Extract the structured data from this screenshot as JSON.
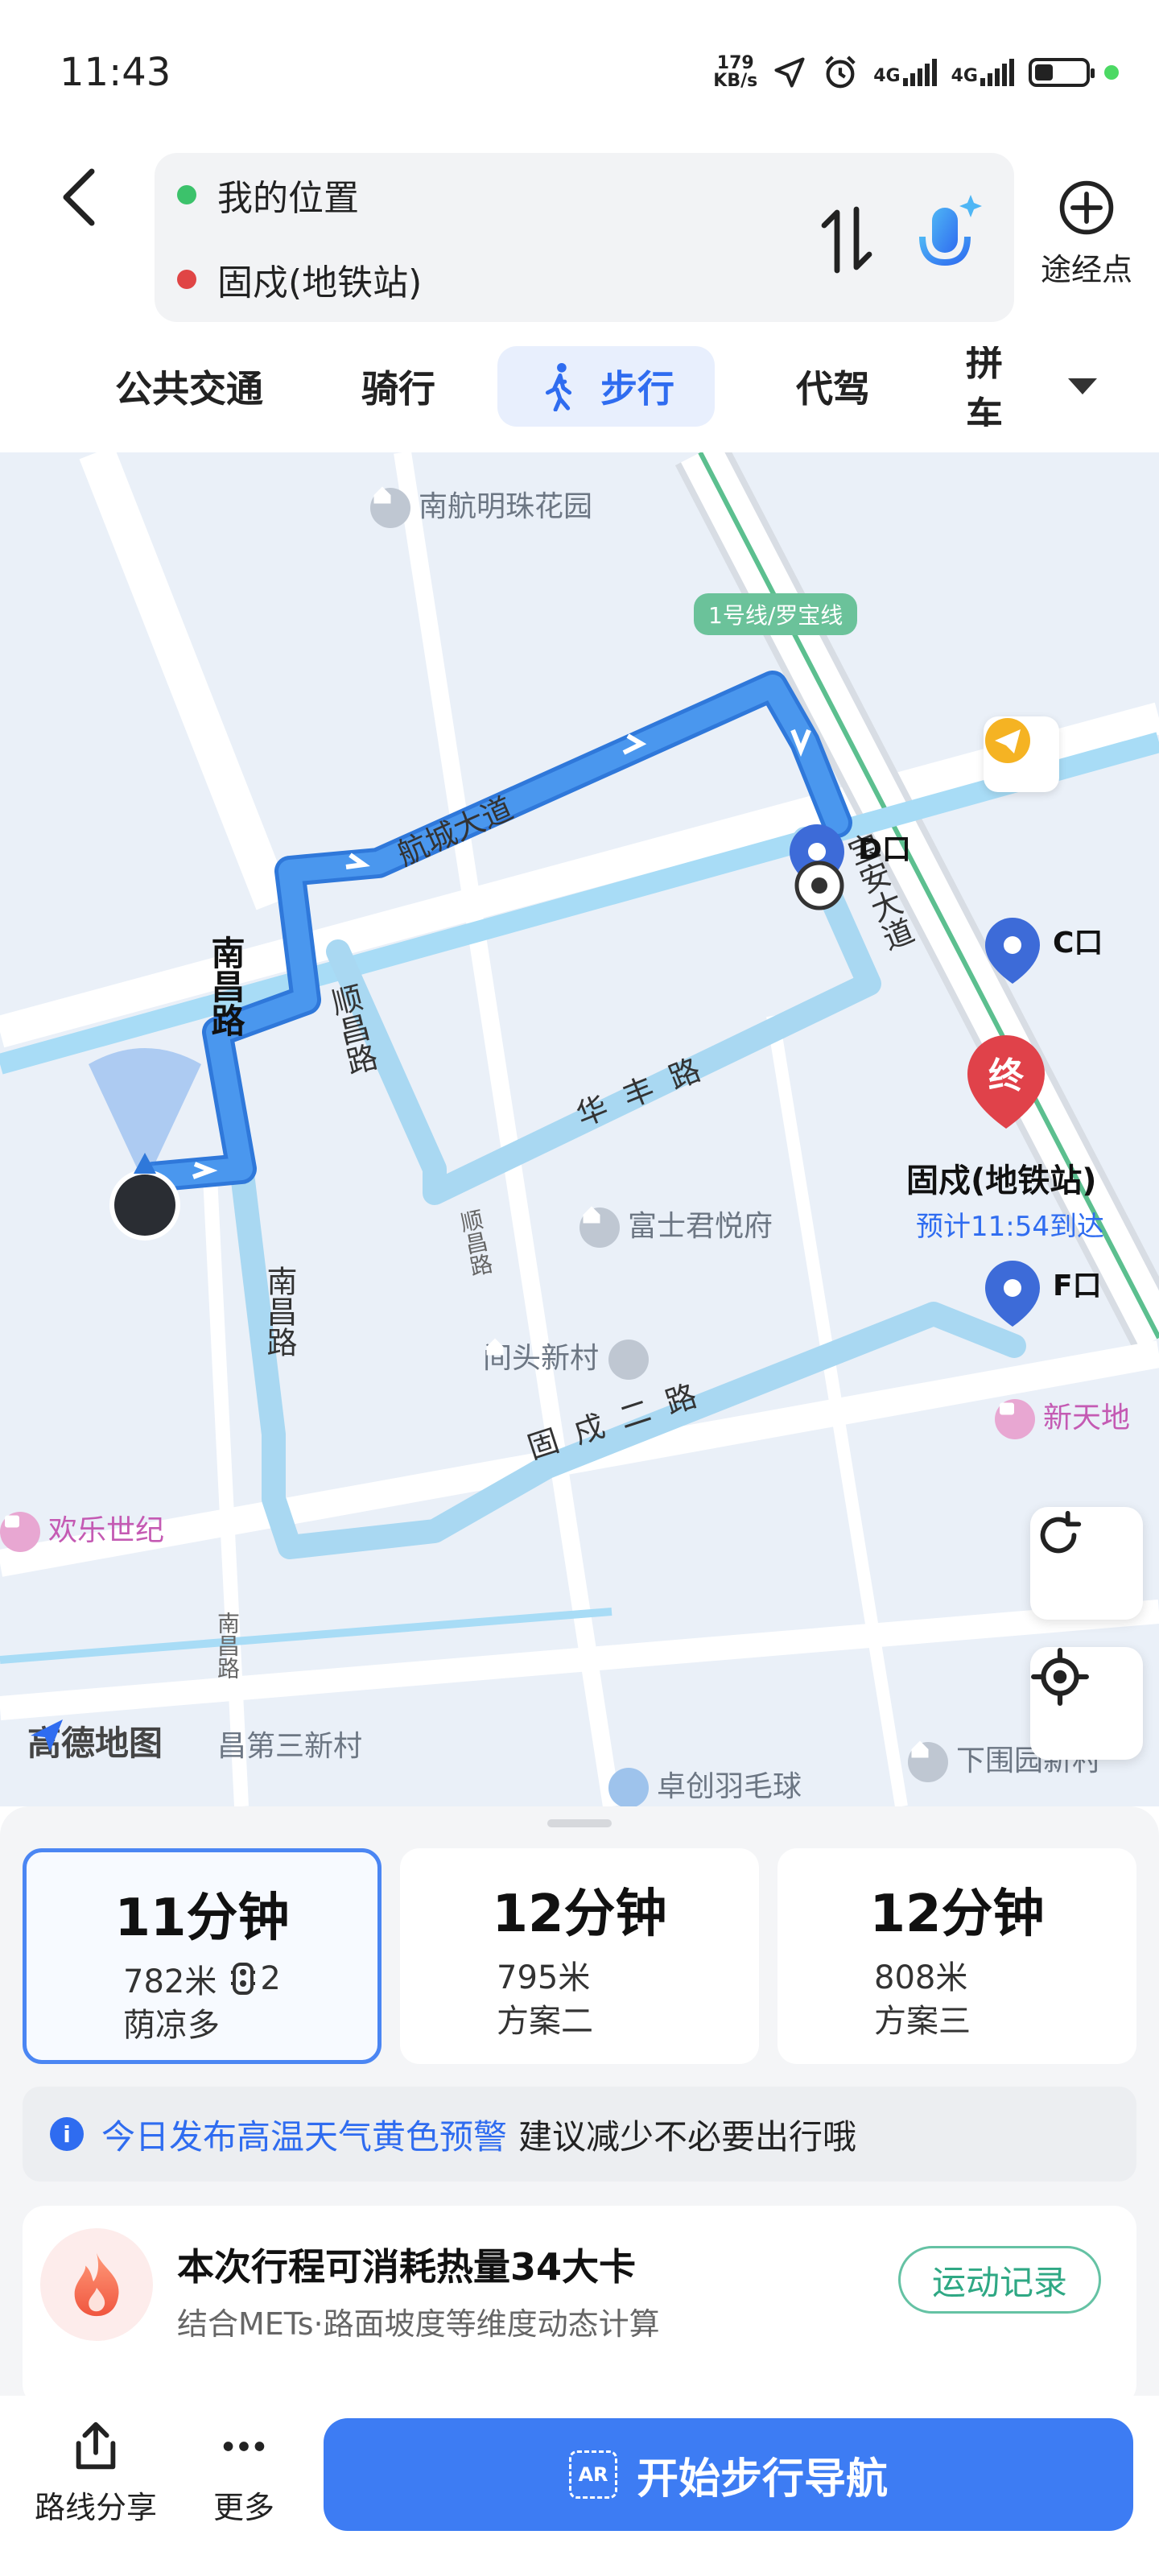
{
  "status_bar": {
    "time": "11:43",
    "net_speed_value": "179",
    "net_speed_unit": "KB/s",
    "signal1_label": "4G",
    "signal2_label": "4G",
    "icons": [
      "location-arrow-icon",
      "alarm-icon",
      "signal-icon",
      "battery-icon"
    ]
  },
  "route": {
    "start": "我的位置",
    "end": "固戍(地铁站)",
    "start_color": "#3cc26b",
    "end_color": "#e04545",
    "waypoint_label": "途经点"
  },
  "modes": {
    "tabs": [
      "公共交通",
      "骑行",
      "步行",
      "代驾",
      "拼车"
    ],
    "active": "步行"
  },
  "map": {
    "labels": {
      "poi_nanhang": "南航明珠花园",
      "metro_line": "1号线/罗宝线",
      "road_hangcheng": "航城大道",
      "road_baoan": "宝安大道",
      "road_nanchang1": "南昌路",
      "road_nanchang2": "南昌路",
      "road_nanchang3": "南昌路",
      "road_shunchang": "顺昌路",
      "road_shunchang_small": "顺昌路",
      "road_huafeng": "华丰路",
      "road_guxu2": "固戍二路",
      "poi_fushi": "富士君悦府",
      "poi_jiantou": "间头新村",
      "poi_huanle": "欢乐世纪",
      "poi_xintiandi": "新天地",
      "poi_sancun": "昌第三新村",
      "poi_zhuochuang": "卓创羽毛球",
      "poi_xiawei": "下围园新村",
      "exit_d": "D口",
      "exit_c": "C口",
      "exit_f": "F口",
      "end_marker": "终",
      "destination": "固戍(地铁站)",
      "eta": "预计11:54到达",
      "logo": "高德地图"
    },
    "colors": {
      "route_main": "#3b86e8",
      "route_alt": "#a9d8f2",
      "water": "#a8dcf6",
      "end_marker": "#e0424a"
    }
  },
  "plans": [
    {
      "time": "11分钟",
      "distance": "782米",
      "lights": "2",
      "note": "荫凉多",
      "selected": true
    },
    {
      "time": "12分钟",
      "distance": "795米",
      "note": "方案二",
      "selected": false
    },
    {
      "time": "12分钟",
      "distance": "808米",
      "note": "方案三",
      "selected": false
    }
  ],
  "warning": {
    "title": "今日发布高温天气黄色预警",
    "text": "建议减少不必要出行哦"
  },
  "calorie": {
    "title": "本次行程可消耗热量34大卡",
    "sub": "结合METs·路面坡度等维度动态计算",
    "button": "运动记录"
  },
  "actions": {
    "share": "路线分享",
    "more": "更多",
    "nav": "开始步行导航",
    "ar_badge": "AR"
  }
}
